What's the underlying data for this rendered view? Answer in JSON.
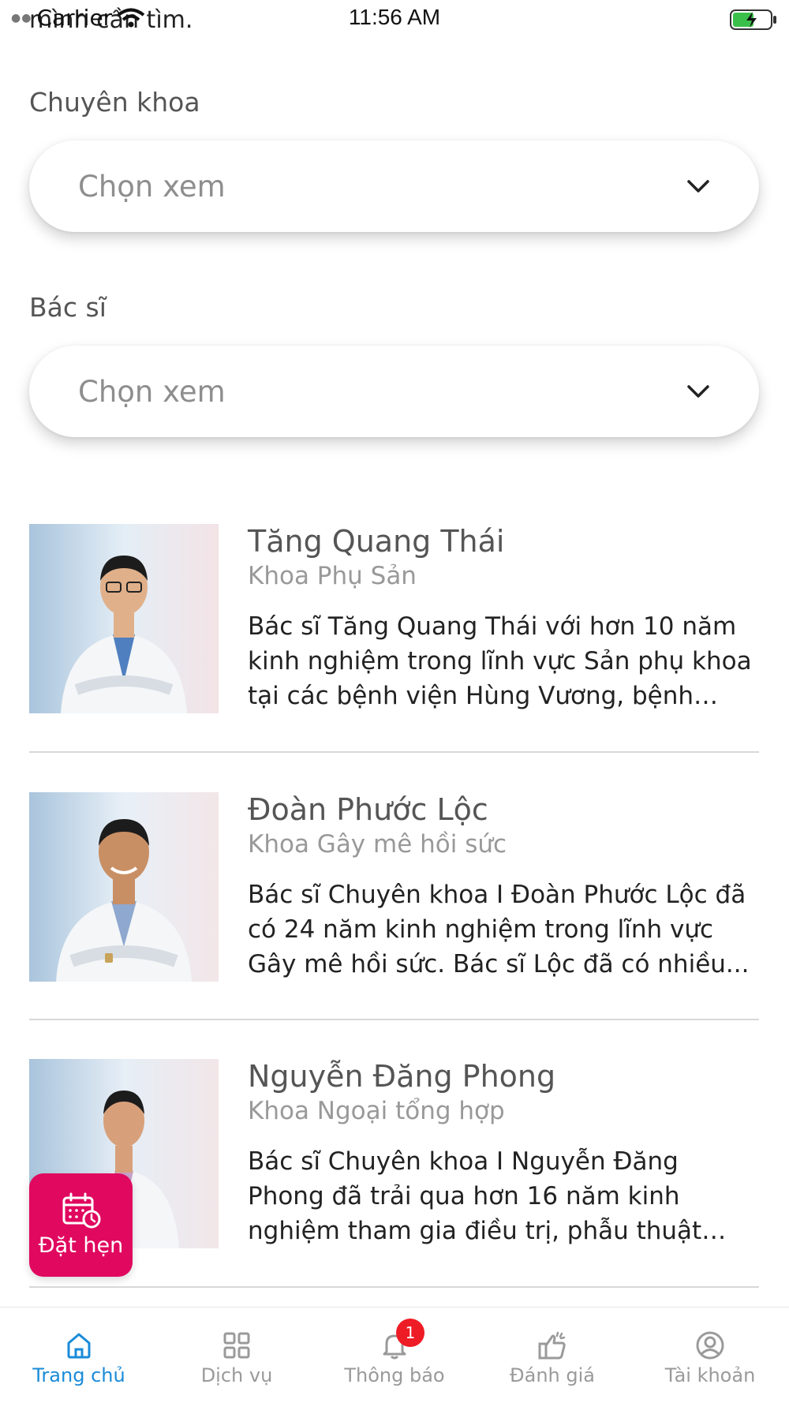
{
  "status_bar": {
    "carrier": "Carrier",
    "time": "11:56 AM",
    "overlap_text": "mình cần tìm."
  },
  "filters": {
    "specialty": {
      "label": "Chuyên khoa",
      "value": "Chọn xem"
    },
    "doctor": {
      "label": "Bác sĩ",
      "value": "Chọn xem"
    }
  },
  "doctors": [
    {
      "name": "Tăng Quang Thái",
      "department": "Khoa Phụ Sản",
      "description": "Bác sĩ Tăng Quang Thái với hơn 10 năm kinh nghiệm trong lĩnh vực Sản phụ khoa tại các bệnh viện Hùng Vương, bệnh việ..."
    },
    {
      "name": "Đoàn Phước Lộc",
      "department": "Khoa Gây mê hồi sức",
      "description": "Bác sĩ Chuyên khoa I Đoàn Phước Lộc đã có 24 năm kinh nghiệm trong lĩnh vực Gây mê hồi sức. Bác sĩ Lộc đã có nhiều..."
    },
    {
      "name": "Nguyễn Đăng Phong",
      "department": "Khoa Ngoại tổng hợp",
      "description": "Bác sĩ Chuyên khoa I Nguyễn Đăng Phong đã trải qua hơn 16 năm kinh nghiệm tham gia điều trị, phẫu thuật nội..."
    }
  ],
  "book_button": {
    "label": "Đặt hẹn",
    "icon": "calendar-clock-icon",
    "color": "#e0085f"
  },
  "tab_bar": {
    "active_color": "#1a8bd8",
    "tabs": [
      {
        "label": "Trang chủ",
        "icon": "home-icon",
        "active": true
      },
      {
        "label": "Dịch vụ",
        "icon": "grid-icon",
        "active": false
      },
      {
        "label": "Thông báo",
        "icon": "bell-icon",
        "active": false,
        "badge": "1"
      },
      {
        "label": "Đánh giá",
        "icon": "thumbs-up-icon",
        "active": false
      },
      {
        "label": "Tài khoản",
        "icon": "user-circle-icon",
        "active": false
      }
    ]
  }
}
